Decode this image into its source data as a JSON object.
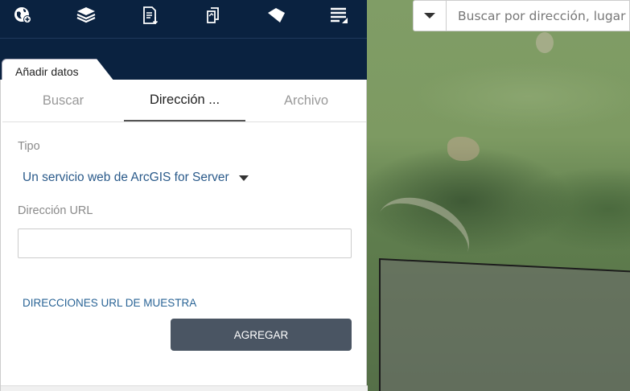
{
  "toolbar": {
    "icons": [
      "globe-add-icon",
      "layers-icon",
      "document-list-icon",
      "print-icon",
      "tag-icon",
      "menu-icon"
    ]
  },
  "search": {
    "placeholder": "Buscar por dirección, lugar"
  },
  "panel": {
    "header_tab": "Añadir datos",
    "tabs": [
      {
        "label": "Buscar",
        "active": false
      },
      {
        "label": "Dirección ...",
        "active": true
      },
      {
        "label": "Archivo",
        "active": false
      }
    ],
    "type_label": "Tipo",
    "type_value": "Un servicio web de ArcGIS for Server",
    "url_label": "Dirección URL",
    "url_value": "",
    "sample_link": "DIRECCIONES URL DE MUESTRA",
    "add_button": "AGREGAR"
  },
  "colors": {
    "toolbar_bg": "#0a2240",
    "link": "#2a6496",
    "button_bg": "#4a5563"
  }
}
